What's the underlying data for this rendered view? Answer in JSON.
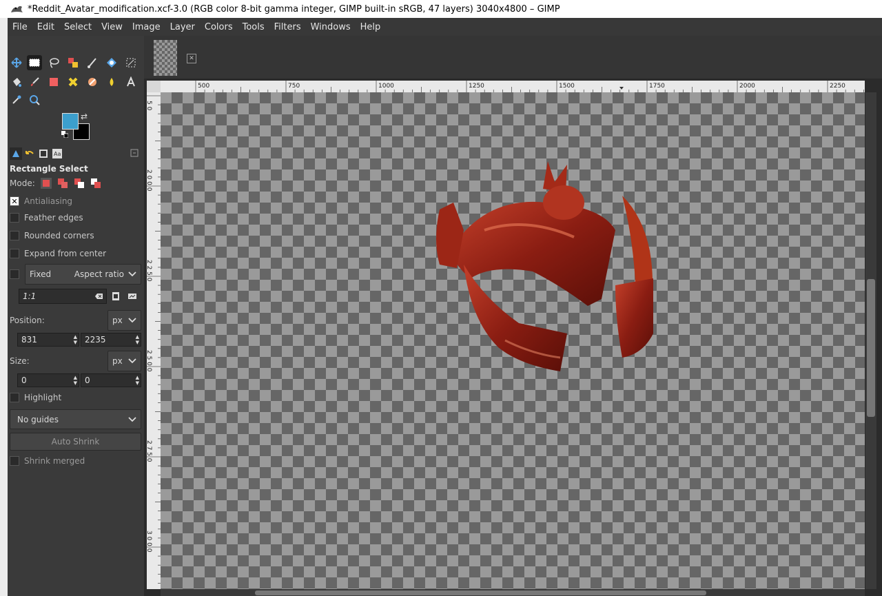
{
  "window": {
    "title": "*Reddit_Avatar_modification.xcf-3.0 (RGB color 8-bit gamma integer, GIMP built-in sRGB, 47 layers) 3040x4800 – GIMP"
  },
  "menu": [
    "File",
    "Edit",
    "Select",
    "View",
    "Image",
    "Layer",
    "Colors",
    "Tools",
    "Filters",
    "Windows",
    "Help"
  ],
  "colors": {
    "foreground": "#3c9fcd",
    "background": "#000000"
  },
  "tool_options": {
    "title": "Rectangle Select",
    "mode_label": "Mode:",
    "antialiasing": {
      "label": "Antialiasing",
      "checked": true
    },
    "feather_edges": {
      "label": "Feather edges",
      "checked": false
    },
    "rounded_corners": {
      "label": "Rounded corners",
      "checked": false
    },
    "expand_from_center": {
      "label": "Expand from center",
      "checked": false
    },
    "fixed": {
      "label": "Fixed",
      "checked": false,
      "option": "Aspect ratio"
    },
    "ratio_value": "1:1",
    "position": {
      "label": "Position:",
      "unit": "px",
      "x": "831",
      "y": "2235"
    },
    "size": {
      "label": "Size:",
      "unit": "px",
      "w": "0",
      "h": "0"
    },
    "highlight": {
      "label": "Highlight",
      "checked": false
    },
    "guides": "No guides",
    "auto_shrink": "Auto Shrink",
    "shrink_merged": {
      "label": "Shrink merged",
      "checked": false
    }
  },
  "rulers": {
    "horizontal": [
      "500",
      "750",
      "1000",
      "1250",
      "1500",
      "1750",
      "2000",
      "2250"
    ],
    "vertical": [
      "5 0",
      "2 0 0 0",
      "2 2 5 0",
      "2 5 0 0",
      "2 7 5 0",
      "3 0 0 0"
    ]
  },
  "icons": {
    "tools": [
      "move-tool-icon",
      "rect-select-icon",
      "lasso-icon",
      "foreground-select-icon",
      "crop-icon",
      "warp-icon",
      "transform-icon",
      "bucket-fill-icon",
      "paintbrush-icon",
      "eraser-icon",
      "heal-icon",
      "smudge-icon",
      "dodge-icon",
      "ink-icon",
      "text-icon",
      "color-picker-icon",
      "zoom-icon"
    ]
  }
}
